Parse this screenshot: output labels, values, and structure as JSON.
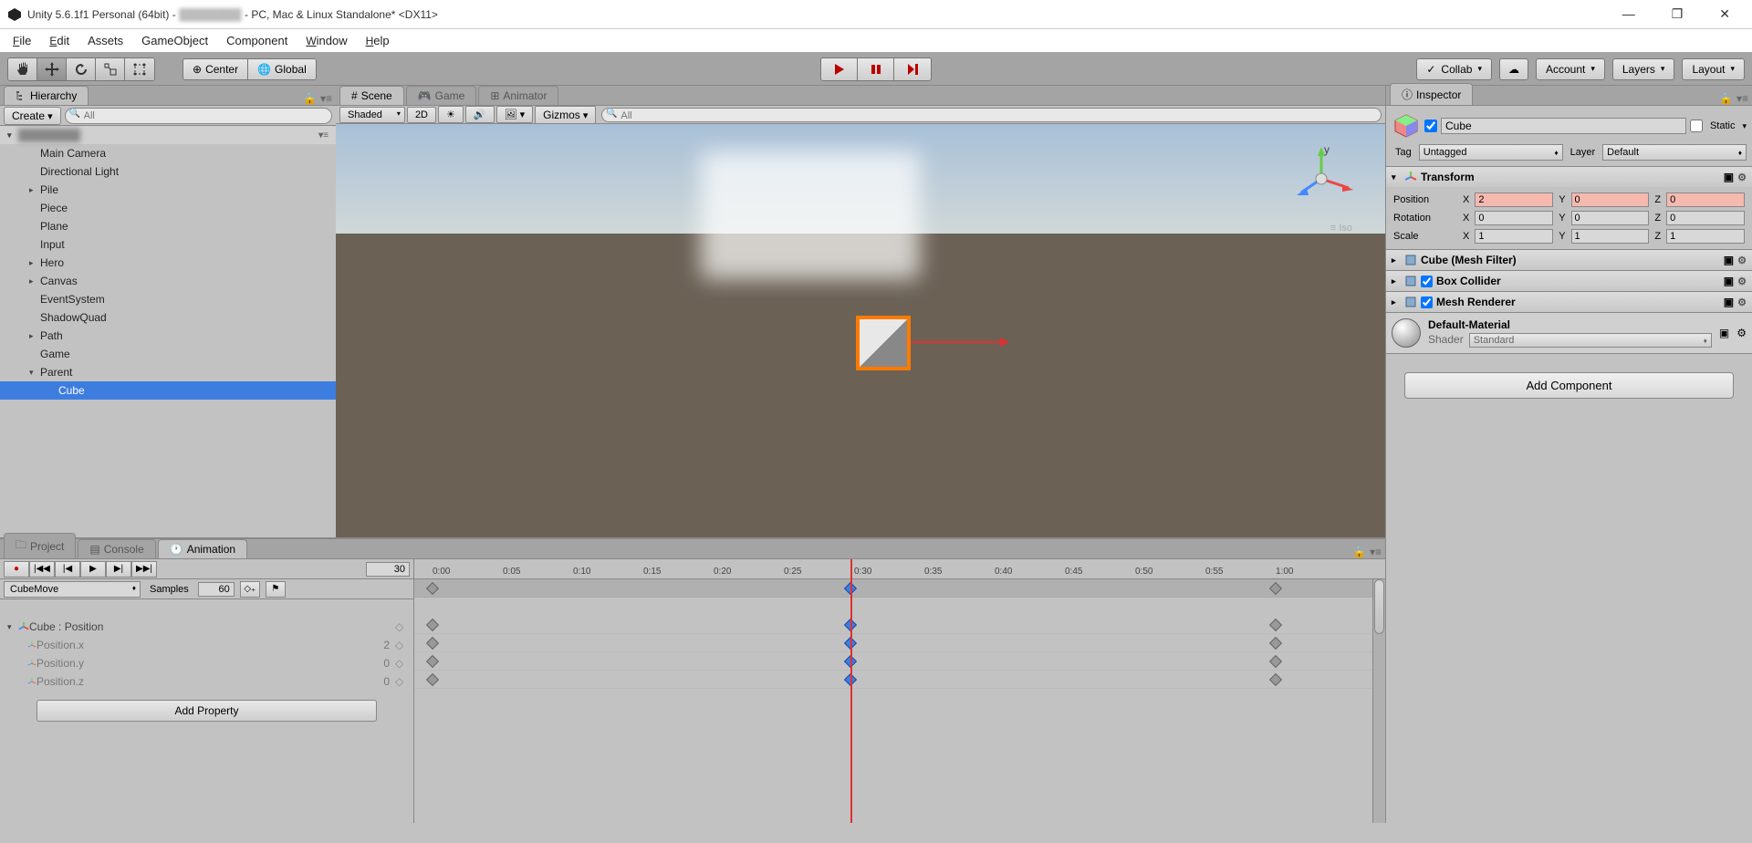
{
  "titlebar": {
    "app": "Unity 5.6.1f1 Personal (64bit) -",
    "suffix": "- PC, Mac & Linux Standalone* <DX11>"
  },
  "menu": [
    "File",
    "Edit",
    "Assets",
    "GameObject",
    "Component",
    "Window",
    "Help"
  ],
  "toolbar": {
    "pivot": "Center",
    "handle": "Global",
    "collab": "Collab",
    "account": "Account",
    "layers": "Layers",
    "layout": "Layout"
  },
  "hierarchy": {
    "tab": "Hierarchy",
    "create": "Create",
    "search_placeholder": "All",
    "root_expand": "▾",
    "items": [
      {
        "name": "Main Camera",
        "indent": 1,
        "fold": ""
      },
      {
        "name": "Directional Light",
        "indent": 1,
        "fold": ""
      },
      {
        "name": "Pile",
        "indent": 1,
        "fold": "▸"
      },
      {
        "name": "Piece",
        "indent": 1,
        "fold": ""
      },
      {
        "name": "Plane",
        "indent": 1,
        "fold": ""
      },
      {
        "name": "Input",
        "indent": 1,
        "fold": ""
      },
      {
        "name": "Hero",
        "indent": 1,
        "fold": "▸"
      },
      {
        "name": "Canvas",
        "indent": 1,
        "fold": "▸"
      },
      {
        "name": "EventSystem",
        "indent": 1,
        "fold": ""
      },
      {
        "name": "ShadowQuad",
        "indent": 1,
        "fold": ""
      },
      {
        "name": "Path",
        "indent": 1,
        "fold": "▸"
      },
      {
        "name": "Game",
        "indent": 1,
        "fold": ""
      },
      {
        "name": "Parent",
        "indent": 1,
        "fold": "▾"
      },
      {
        "name": "Cube",
        "indent": 2,
        "fold": "",
        "selected": true
      }
    ]
  },
  "scene": {
    "tabs": [
      "Scene",
      "Game",
      "Animator"
    ],
    "shading": "Shaded",
    "mode_2d": "2D",
    "gizmos": "Gizmos",
    "search_placeholder": "All",
    "iso": "≡ Iso"
  },
  "bottom_tabs": [
    "Project",
    "Console",
    "Animation"
  ],
  "animation": {
    "frame": "30",
    "clip": "CubeMove",
    "samples_label": "Samples",
    "samples": "60",
    "ticks": [
      "0:00",
      "0:05",
      "0:10",
      "0:15",
      "0:20",
      "0:25",
      "0:30",
      "0:35",
      "0:40",
      "0:45",
      "0:50",
      "0:55",
      "1:00"
    ],
    "props": {
      "root": "Cube : Position",
      "children": [
        {
          "name": "Position.x",
          "val": "2"
        },
        {
          "name": "Position.y",
          "val": "0"
        },
        {
          "name": "Position.z",
          "val": "0"
        }
      ]
    },
    "add_property": "Add Property"
  },
  "inspector": {
    "tab": "Inspector",
    "name": "Cube",
    "static": "Static",
    "tag_label": "Tag",
    "tag": "Untagged",
    "layer_label": "Layer",
    "layer": "Default",
    "transform": {
      "title": "Transform",
      "rows": [
        {
          "label": "Position",
          "x": "2",
          "y": "0",
          "z": "0",
          "hx": true,
          "hy": true,
          "hz": true
        },
        {
          "label": "Rotation",
          "x": "0",
          "y": "0",
          "z": "0"
        },
        {
          "label": "Scale",
          "x": "1",
          "y": "1",
          "z": "1"
        }
      ]
    },
    "components": [
      {
        "title": "Cube (Mesh Filter)",
        "check": false
      },
      {
        "title": "Box Collider",
        "check": true
      },
      {
        "title": "Mesh Renderer",
        "check": true
      }
    ],
    "material": {
      "name": "Default-Material",
      "shader_label": "Shader",
      "shader": "Standard"
    },
    "add_component": "Add Component"
  }
}
